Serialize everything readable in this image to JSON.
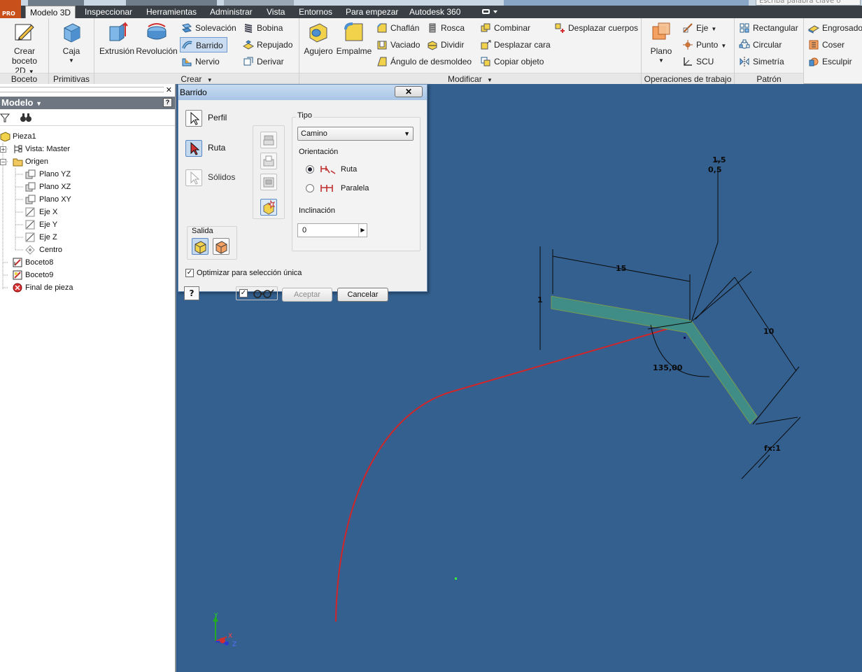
{
  "app": {
    "pro_label": "PRO",
    "search_placeholder": "Escriba palabra clave o frase"
  },
  "tabs": [
    {
      "label": "Modelo 3D",
      "active": true
    },
    {
      "label": "Inspeccionar"
    },
    {
      "label": "Herramientas"
    },
    {
      "label": "Administrar"
    },
    {
      "label": "Vista"
    },
    {
      "label": "Entornos"
    },
    {
      "label": "Para empezar"
    },
    {
      "label": "Autodesk 360"
    }
  ],
  "ribbon": {
    "boceto": {
      "label": "Boceto",
      "crear_boceto": "Crear\nboceto 2D"
    },
    "primitivas": {
      "label": "Primitivas",
      "caja": "Caja"
    },
    "crear": {
      "label": "Crear",
      "extrusion": "Extrusión",
      "revolucion": "Revolución",
      "solevacion": "Solevación",
      "barrido": "Barrido",
      "nervio": "Nervio",
      "bobina": "Bobina",
      "repujado": "Repujado",
      "derivar": "Derivar"
    },
    "modificar": {
      "label": "Modificar",
      "agujero": "Agujero",
      "empalme": "Empalme",
      "chaflan": "Chaflán",
      "vaciado": "Vaciado",
      "angulo": "Ángulo de desmoldeo",
      "rosca": "Rosca",
      "dividir": "Dividir",
      "combinar": "Combinar",
      "desplazar_cara": "Desplazar cara",
      "copiar_objeto": "Copiar objeto",
      "desplazar_cuerpos": "Desplazar cuerpos"
    },
    "operaciones": {
      "label": "Operaciones de trabajo",
      "plano": "Plano",
      "eje": "Eje",
      "punto": "Punto",
      "scu": "SCU"
    },
    "patron": {
      "label": "Patrón",
      "rectangular": "Rectangular",
      "circular": "Circular",
      "simetria": "Simetría"
    },
    "superficie": {
      "engrosado": "Engrosado",
      "coser": "Coser",
      "esculpir": "Esculpir"
    }
  },
  "browser": {
    "title": "Modelo",
    "tree": [
      {
        "label": "Pieza1",
        "icon": "part-icon"
      },
      {
        "label": "Vista: Master",
        "icon": "view-icon"
      },
      {
        "label": "Origen",
        "icon": "folder-icon"
      },
      {
        "label": "Plano YZ",
        "icon": "plane-icon"
      },
      {
        "label": "Plano XZ",
        "icon": "plane-icon"
      },
      {
        "label": "Plano XY",
        "icon": "plane-icon"
      },
      {
        "label": "Eje X",
        "icon": "axis-icon"
      },
      {
        "label": "Eje Y",
        "icon": "axis-icon"
      },
      {
        "label": "Eje Z",
        "icon": "axis-icon"
      },
      {
        "label": "Centro",
        "icon": "point-icon"
      },
      {
        "label": "Boceto8",
        "icon": "sketch-icon"
      },
      {
        "label": "Boceto9",
        "icon": "sketch-icon"
      },
      {
        "label": "Final de pieza",
        "icon": "end-of-part-icon"
      }
    ]
  },
  "dialog": {
    "title": "Barrido",
    "perfil": "Perfil",
    "ruta": "Ruta",
    "solidos": "Sólidos",
    "salida": "Salida",
    "tipo_label": "Tipo",
    "tipo_value": "Camino",
    "orientacion_label": "Orientación",
    "orient_ruta": "Ruta",
    "orient_paralela": "Paralela",
    "orientation_selected": "Ruta",
    "inclinacion_label": "Inclinación",
    "inclinacion_value": "0",
    "optimizar": "Optimizar para selección única",
    "aceptar": "Aceptar",
    "cancelar": "Cancelar"
  },
  "sketch": {
    "dim_15": "15",
    "dim_10": "10",
    "dim_angle": "135,00",
    "dim_1_5": "1,5",
    "dim_0_5": "0,5",
    "dim_1": "1",
    "dim_fx": "fx:1"
  },
  "colors": {
    "canvas": "#33608f",
    "path": "#d0262a",
    "profile_fill": "#3f8d86",
    "ribbon": "#f3f3f3",
    "tabbar": "#3a3f45"
  }
}
